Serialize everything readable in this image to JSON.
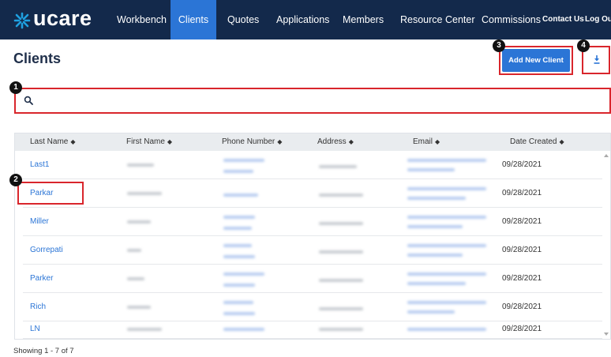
{
  "brand": {
    "logo_text": "ucare"
  },
  "nav": {
    "items": [
      {
        "label": "Workbench",
        "active": false
      },
      {
        "label": "Clients",
        "active": true
      },
      {
        "label": "Quotes",
        "active": false
      },
      {
        "label": "Applications",
        "active": false
      },
      {
        "label": "Members",
        "active": false
      },
      {
        "label": "Resource Center",
        "active": false
      },
      {
        "label": "Commissions",
        "active": false
      }
    ],
    "contact_label": "Contact Us",
    "logout_label": "Log Out"
  },
  "page": {
    "title": "Clients"
  },
  "actions": {
    "add_client_label": "Add New Client",
    "download_icon": "download-icon"
  },
  "callouts": [
    "1",
    "2",
    "3",
    "4"
  ],
  "search": {
    "placeholder": "",
    "icon": "search-icon"
  },
  "table": {
    "columns": [
      "Last Name",
      "First Name",
      "Phone Number",
      "Address",
      "Email",
      "Date Created"
    ],
    "sort_glyph": "◆",
    "rows": [
      {
        "last_name": "Last1",
        "date_created": "09/28/2021"
      },
      {
        "last_name": "Parkar",
        "date_created": "09/28/2021"
      },
      {
        "last_name": "Miller",
        "date_created": "09/28/2021"
      },
      {
        "last_name": "Gorrepati",
        "date_created": "09/28/2021"
      },
      {
        "last_name": "Parker",
        "date_created": "09/28/2021"
      },
      {
        "last_name": "Rich",
        "date_created": "09/28/2021"
      },
      {
        "last_name": "LN",
        "date_created": "09/28/2021"
      }
    ]
  },
  "footer": {
    "showing": "Showing 1 - 7 of 7"
  },
  "colors": {
    "nav_bg": "#13294b",
    "accent": "#2b75d6",
    "callout": "#d9262c"
  }
}
